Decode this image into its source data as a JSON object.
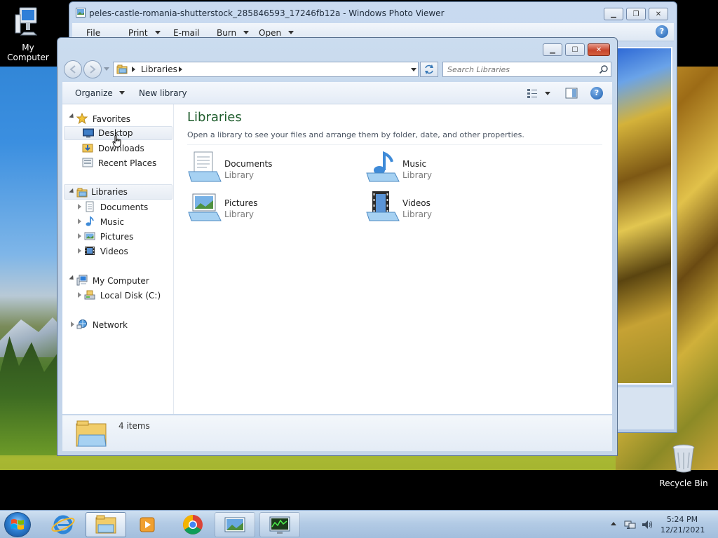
{
  "desktop": {
    "icons": {
      "my_computer": "My Computer",
      "recycle_bin": "Recycle Bin"
    }
  },
  "photo_viewer": {
    "title": "peles-castle-romania-shutterstock_285846593_17246fb12a - Windows Photo Viewer",
    "menu": [
      "File",
      "Print",
      "E-mail",
      "Burn",
      "Open"
    ]
  },
  "explorer": {
    "address": {
      "crumbs": [
        "Libraries"
      ]
    },
    "search": {
      "placeholder": "Search Libraries"
    },
    "toolbar": {
      "organize": "Organize",
      "new_library": "New library"
    },
    "nav": {
      "favorites": "Favorites",
      "desktop": "Desktop",
      "downloads": "Downloads",
      "recent_places": "Recent Places",
      "libraries": "Libraries",
      "documents": "Documents",
      "music": "Music",
      "pictures": "Pictures",
      "videos": "Videos",
      "my_computer": "My Computer",
      "local_disk": "Local Disk (C:)",
      "network": "Network"
    },
    "main": {
      "title": "Libraries",
      "subtitle": "Open a library to see your files and arrange them by folder, date, and other properties.",
      "libraries": [
        {
          "name": "Documents",
          "type": "Library"
        },
        {
          "name": "Music",
          "type": "Library"
        },
        {
          "name": "Pictures",
          "type": "Library"
        },
        {
          "name": "Videos",
          "type": "Library"
        }
      ]
    },
    "details": {
      "count": "4 items"
    }
  },
  "taskbar": {
    "clock": {
      "time": "5:24 PM",
      "date": "12/21/2021"
    }
  }
}
